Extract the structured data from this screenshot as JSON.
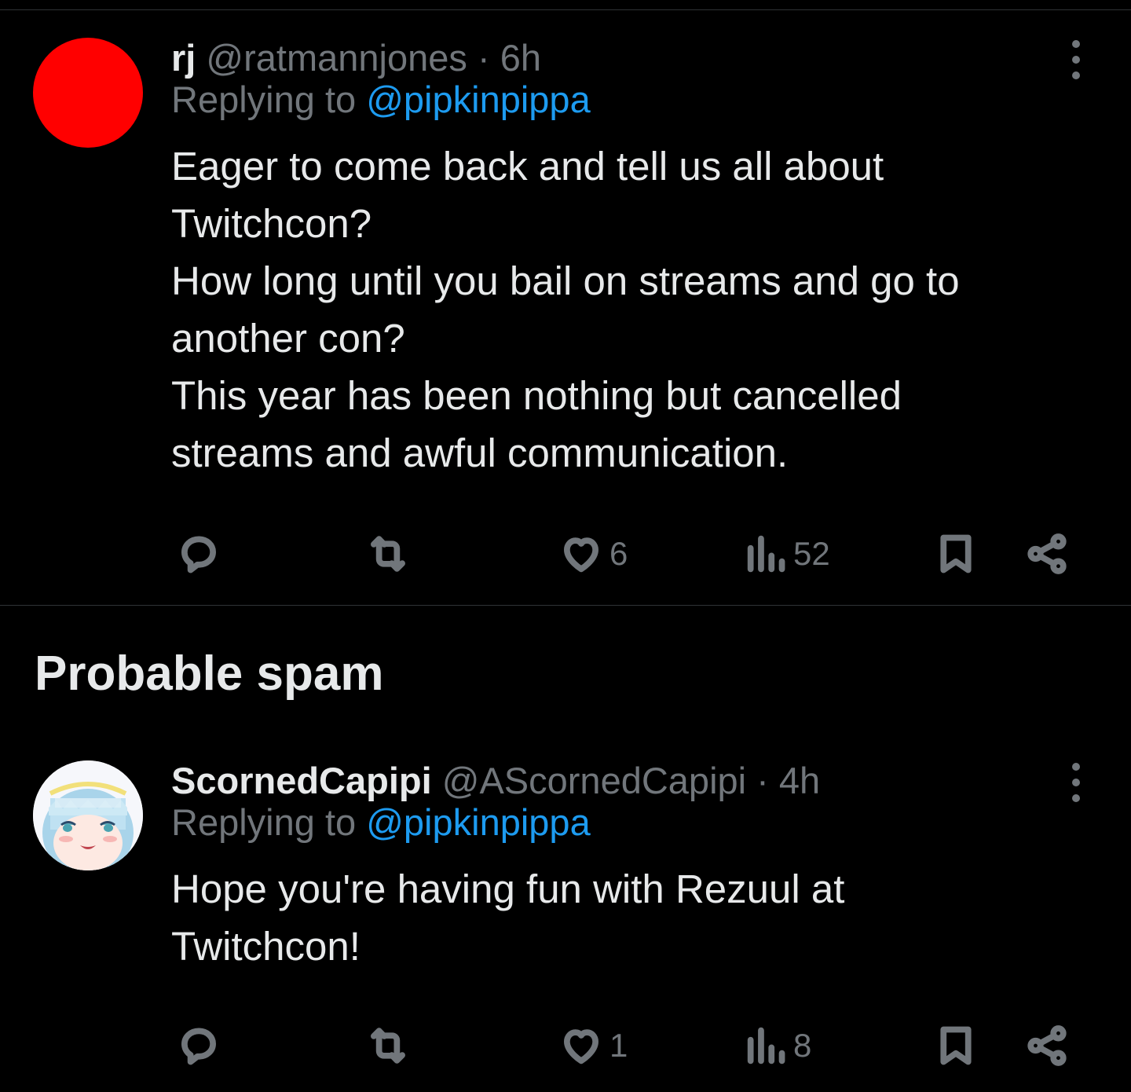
{
  "tweets": [
    {
      "name": "rj",
      "handle": "@ratmannjones",
      "separator": "·",
      "time": "6h",
      "replying_prefix": "Replying to",
      "replying_to": "@pipkinpippa",
      "text": "Eager to come back and tell us all about\nTwitchcon?\nHow long until you bail on streams and go to\nanother con?\nThis year has been nothing but cancelled\nstreams and awful communication.",
      "avatar_color": "#ff0000",
      "likes": "6",
      "views": "52"
    },
    {
      "name": "ScornedCapipi",
      "handle": "@AScornedCapipi",
      "separator": "·",
      "time": "4h",
      "replying_prefix": "Replying to",
      "replying_to": "@pipkinpippa",
      "text": "Hope you're having fun with Rezuul at\nTwitchcon!",
      "likes": "1",
      "views": "8"
    }
  ],
  "section": {
    "title": "Probable spam"
  },
  "colors": {
    "background": "#000000",
    "text": "#e7e9ea",
    "muted": "#71767b",
    "link": "#1d9bf0",
    "divider": "#2f3336"
  },
  "icons": [
    "reply-icon",
    "retweet-icon",
    "like-icon",
    "views-icon",
    "bookmark-icon",
    "share-icon",
    "more-icon"
  ]
}
